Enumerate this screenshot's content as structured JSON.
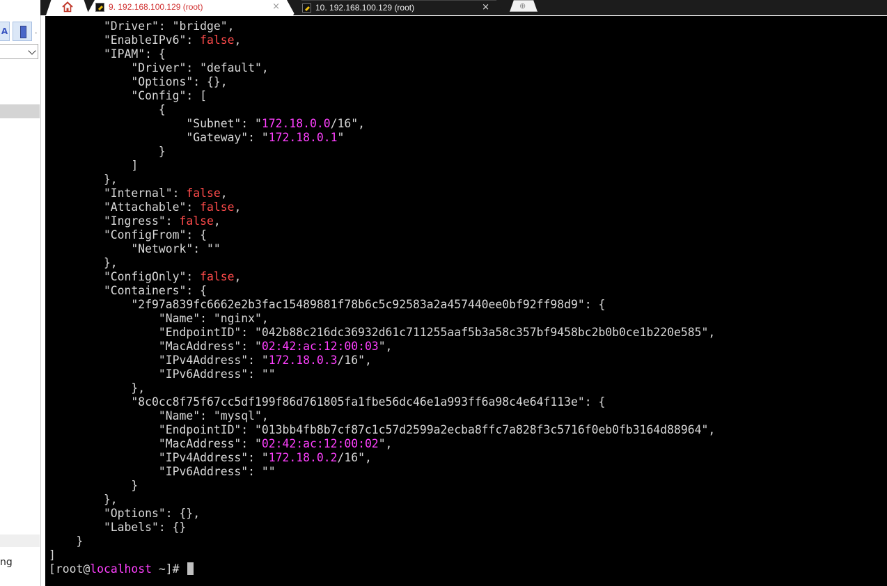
{
  "tabs": {
    "home_icon": "home-icon",
    "items": [
      {
        "label": "9. 192.168.100.129 (root)",
        "state": "inactive",
        "color": "#d03030"
      },
      {
        "label": "10. 192.168.100.129 (root)",
        "state": "active"
      }
    ],
    "close_glyph": "×",
    "new_tab_icon": "plus-icon"
  },
  "sidebar": {
    "toolbar_a_label": "A",
    "toolbar_c_label": ".",
    "partial_text": "ng"
  },
  "terminal": {
    "colors": {
      "background": "#000000",
      "text": "#d8d8d8",
      "false": "#ff4b4b",
      "highlight": "#ff40ff"
    },
    "lines": [
      [
        [
          "        \"Driver\": \"bridge\",",
          ""
        ]
      ],
      [
        [
          "        \"EnableIPv6\": ",
          ""
        ],
        [
          "false",
          "f"
        ],
        [
          ",",
          ""
        ]
      ],
      [
        [
          "        \"IPAM\": {",
          ""
        ]
      ],
      [
        [
          "            \"Driver\": \"default\",",
          ""
        ]
      ],
      [
        [
          "            \"Options\": {},",
          ""
        ]
      ],
      [
        [
          "            \"Config\": [",
          ""
        ]
      ],
      [
        [
          "                {",
          ""
        ]
      ],
      [
        [
          "                    \"Subnet\": \"",
          ""
        ],
        [
          "172.18.0.0",
          "m"
        ],
        [
          "/16\",",
          ""
        ]
      ],
      [
        [
          "                    \"Gateway\": \"",
          ""
        ],
        [
          "172.18.0.1",
          "m"
        ],
        [
          "\"",
          ""
        ]
      ],
      [
        [
          "                }",
          ""
        ]
      ],
      [
        [
          "            ]",
          ""
        ]
      ],
      [
        [
          "        },",
          ""
        ]
      ],
      [
        [
          "        \"Internal\": ",
          ""
        ],
        [
          "false",
          "f"
        ],
        [
          ",",
          ""
        ]
      ],
      [
        [
          "        \"Attachable\": ",
          ""
        ],
        [
          "false",
          "f"
        ],
        [
          ",",
          ""
        ]
      ],
      [
        [
          "        \"Ingress\": ",
          ""
        ],
        [
          "false",
          "f"
        ],
        [
          ",",
          ""
        ]
      ],
      [
        [
          "        \"ConfigFrom\": {",
          ""
        ]
      ],
      [
        [
          "            \"Network\": \"\"",
          ""
        ]
      ],
      [
        [
          "        },",
          ""
        ]
      ],
      [
        [
          "        \"ConfigOnly\": ",
          ""
        ],
        [
          "false",
          "f"
        ],
        [
          ",",
          ""
        ]
      ],
      [
        [
          "        \"Containers\": {",
          ""
        ]
      ],
      [
        [
          "            \"2f97a839fc6662e2b3fac15489881f78b6c5c92583a2a457440ee0bf92ff98d9\": {",
          ""
        ]
      ],
      [
        [
          "                \"Name\": \"nginx\",",
          ""
        ]
      ],
      [
        [
          "                \"EndpointID\": \"042b88c216dc36932d61c711255aaf5b3a58c357bf9458bc2b0b0ce1b220e585\",",
          ""
        ]
      ],
      [
        [
          "                \"MacAddress\": \"",
          ""
        ],
        [
          "02:42:ac:12:00:03",
          "m"
        ],
        [
          "\",",
          ""
        ]
      ],
      [
        [
          "                \"IPv4Address\": \"",
          ""
        ],
        [
          "172.18.0.3",
          "m"
        ],
        [
          "/16\",",
          ""
        ]
      ],
      [
        [
          "                \"IPv6Address\": \"\"",
          ""
        ]
      ],
      [
        [
          "            },",
          ""
        ]
      ],
      [
        [
          "            \"8c0cc8f75f67cc5df199f86d761805fa1fbe56dc46e1a993ff6a98c4e64f113e\": {",
          ""
        ]
      ],
      [
        [
          "                \"Name\": \"mysql\",",
          ""
        ]
      ],
      [
        [
          "                \"EndpointID\": \"013bb4fb8b7cf87c1c57d2599a2ecba8ffc7a828f3c5716f0eb0fb3164d88964\",",
          ""
        ]
      ],
      [
        [
          "                \"MacAddress\": \"",
          ""
        ],
        [
          "02:42:ac:12:00:02",
          "m"
        ],
        [
          "\",",
          ""
        ]
      ],
      [
        [
          "                \"IPv4Address\": \"",
          ""
        ],
        [
          "172.18.0.2",
          "m"
        ],
        [
          "/16\",",
          ""
        ]
      ],
      [
        [
          "                \"IPv6Address\": \"\"",
          ""
        ]
      ],
      [
        [
          "            }",
          ""
        ]
      ],
      [
        [
          "        },",
          ""
        ]
      ],
      [
        [
          "        \"Options\": {},",
          ""
        ]
      ],
      [
        [
          "        \"Labels\": {}",
          ""
        ]
      ],
      [
        [
          "    }",
          ""
        ]
      ],
      [
        [
          "]",
          ""
        ]
      ]
    ],
    "prompt": {
      "user": "[root@",
      "host": "localhost",
      "rest": " ~]# "
    }
  }
}
